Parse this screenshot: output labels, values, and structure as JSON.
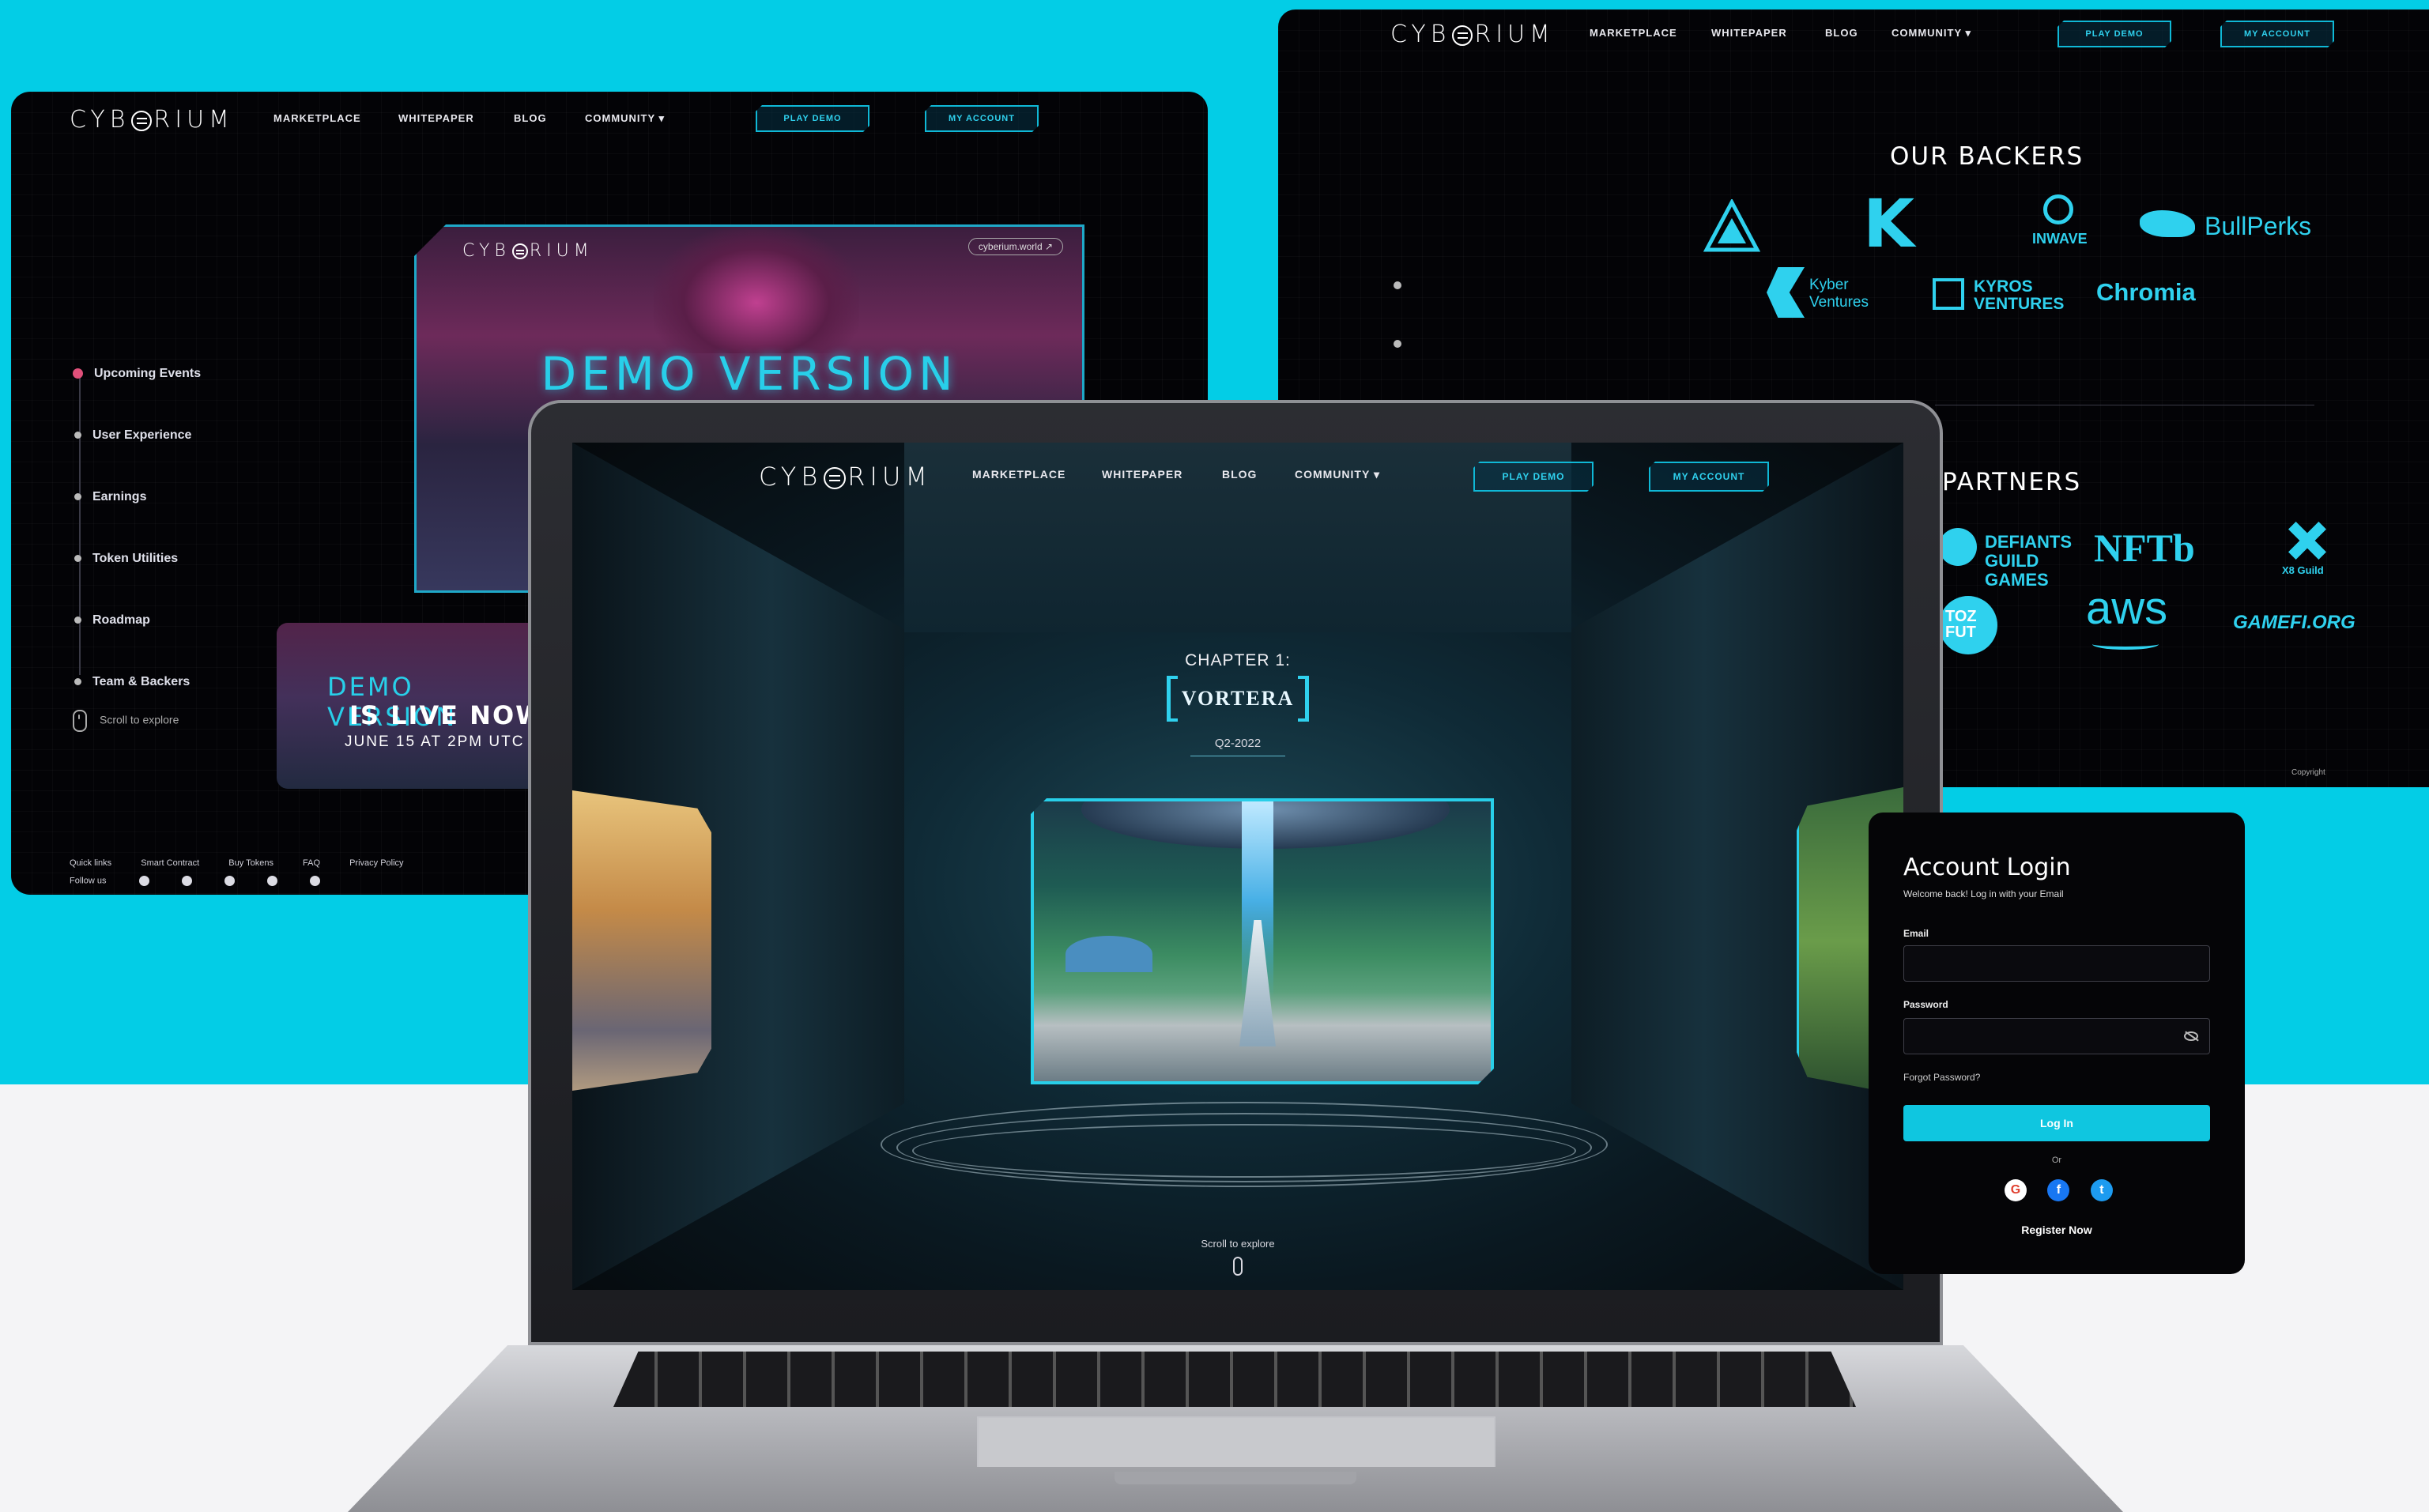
{
  "brand": {
    "logo_text_pre": "CYB",
    "logo_text_post": "RIUM"
  },
  "nav": {
    "marketplace": "MARKETPLACE",
    "whitepaper": "WHITEPAPER",
    "blog": "BLOG",
    "community": "COMMUNITY ▾",
    "play_demo": "PLAY DEMO",
    "my_account": "MY ACCOUNT"
  },
  "left_panel": {
    "side_nav": [
      "Upcoming Events",
      "User Experience",
      "Earnings",
      "Token Utilities",
      "Roadmap",
      "Team & Backers"
    ],
    "demo_title": "DEMO VERSION",
    "demo_tag": "cyberium.world ↗",
    "demo2_line1": "DEMO VERSION",
    "demo2_line2": "IS LIVE NOW",
    "demo2_line3": "JUNE 15 AT 2PM UTC",
    "scroll_hint": "Scroll to explore",
    "footer_links": [
      "Quick links",
      "Smart Contract",
      "Buy Tokens",
      "FAQ",
      "Privacy Policy"
    ],
    "follow_us": "Follow us"
  },
  "right_panel": {
    "backers_title": "OUR BACKERS",
    "backers": [
      "K",
      "INWAVE",
      "BullPerks",
      "Kyber Ventures",
      "KYROS VENTURES",
      "Chromia"
    ],
    "partners_title": "PARTNERS",
    "partners": [
      "DEFIANTS GUILD GAMES",
      "NFTb",
      "X8 Guild",
      "TOZ FUT",
      "aws",
      "GAMEFI.ORG"
    ],
    "copyright": "Copyright"
  },
  "main_screen": {
    "chapter": "CHAPTER 1:",
    "title": "VORTERA",
    "date": "Q2-2022",
    "scroll_hint": "Scroll to explore"
  },
  "login": {
    "title": "Account Login",
    "subtitle": "Welcome back! Log in with your Email",
    "email_label": "Email",
    "password_label": "Password",
    "forgot": "Forgot Password?",
    "login_button": "Log In",
    "or": "Or",
    "register": "Register Now"
  },
  "colors": {
    "accent": "#03cde6",
    "panel_bg": "#030306",
    "button": "#0fc6e0"
  }
}
